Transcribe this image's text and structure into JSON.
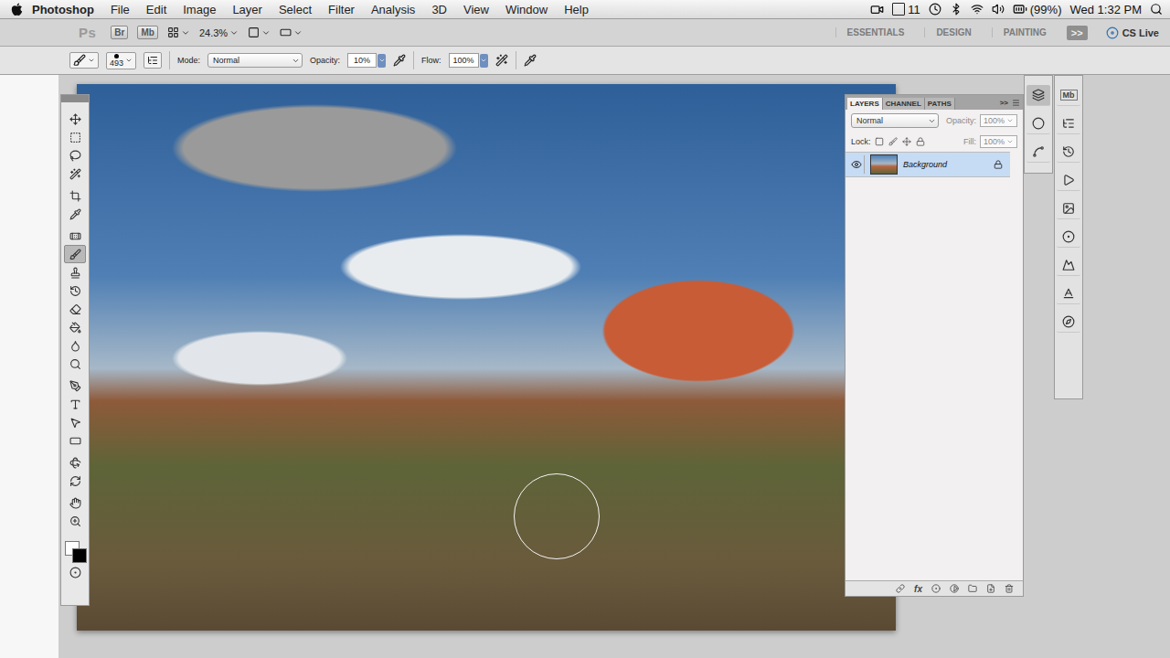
{
  "menu_bar": {
    "app_name": "Photoshop",
    "menus": [
      "File",
      "Edit",
      "Image",
      "Layer",
      "Select",
      "Filter",
      "Analysis",
      "3D",
      "View",
      "Window",
      "Help"
    ],
    "status": {
      "adobe_updates": "11",
      "battery": "(99%)",
      "clock": "Wed 1:32 PM"
    }
  },
  "app_bar": {
    "logo": "Ps",
    "launchers": [
      "Br",
      "Mb"
    ],
    "zoom": "24.3%",
    "workspaces": [
      {
        "label": "ESSENTIALS",
        "selected": false
      },
      {
        "label": "DESIGN",
        "selected": false
      },
      {
        "label": "PAINTING",
        "selected": false
      }
    ],
    "more": ">>",
    "cs_live": "CS Live"
  },
  "options_bar": {
    "brush_size": "493",
    "mode_label": "Mode:",
    "mode": "Normal",
    "opacity_label": "Opacity:",
    "opacity": "10%",
    "flow_label": "Flow:",
    "flow": "100%"
  },
  "tools": [
    {
      "selected": false
    },
    {
      "selected": false
    },
    {
      "selected": false
    },
    {
      "selected": false
    },
    {
      "selected": false
    },
    {
      "selected": false
    },
    {
      "selected": false
    },
    {
      "selected": true
    },
    {
      "selected": false
    },
    {
      "selected": false
    },
    {
      "selected": false
    },
    {
      "selected": false
    },
    {
      "selected": false
    },
    {
      "selected": false
    },
    {
      "selected": false
    },
    {
      "selected": false
    },
    {
      "selected": false
    },
    {
      "selected": false
    },
    {
      "selected": false
    },
    {
      "selected": false
    },
    {
      "selected": false
    },
    {
      "selected": false
    }
  ],
  "dock": {
    "primary": [
      {
        "selected": true
      },
      {
        "selected": false
      },
      {
        "selected": false
      }
    ],
    "secondary_label": "Mb"
  },
  "layers_panel": {
    "tabs": [
      {
        "label": "LAYERS",
        "selected": true
      },
      {
        "label": "CHANNEL",
        "selected": false
      },
      {
        "label": "PATHS",
        "selected": false
      }
    ],
    "more": ">>",
    "blend_mode": "Normal",
    "opacity_label": "Opacity:",
    "opacity": {
      "value": "100%",
      "disabled": true
    },
    "lock_label": "Lock:",
    "fill_label": "Fill:",
    "fill": {
      "value": "100%",
      "disabled": true
    },
    "layers": [
      {
        "name": "Background",
        "visible": true,
        "locked": true,
        "selected": true
      }
    ],
    "footer_fx": "fx"
  }
}
